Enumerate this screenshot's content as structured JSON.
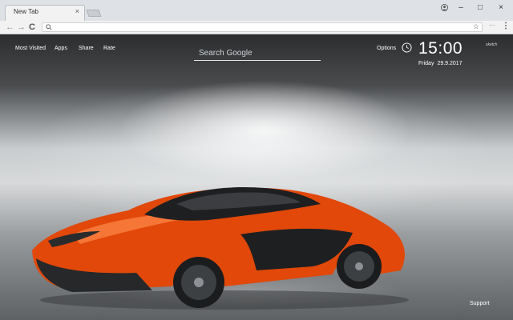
{
  "tab": {
    "title": "New Tab",
    "close": "×"
  },
  "window_controls": {
    "minimize": "–",
    "maximize": "□",
    "close": "×"
  },
  "toolbar": {
    "back": "←",
    "forward": "→",
    "reload": "C",
    "star": "☆",
    "extensions": "···",
    "menu": "⋮",
    "url": ""
  },
  "nav": {
    "most_visited": "Most Visited",
    "apps": "Apps",
    "share": "Share",
    "rate": "Rate"
  },
  "search": {
    "placeholder": "Search Google",
    "value": ""
  },
  "options": "Options",
  "clock": {
    "time": "15:00",
    "day": "Friday",
    "date": "29.9.2017"
  },
  "sub_label": "sketch",
  "support": "Support",
  "colors": {
    "car_body": "#e1480a",
    "car_dark": "#1e1f21"
  }
}
